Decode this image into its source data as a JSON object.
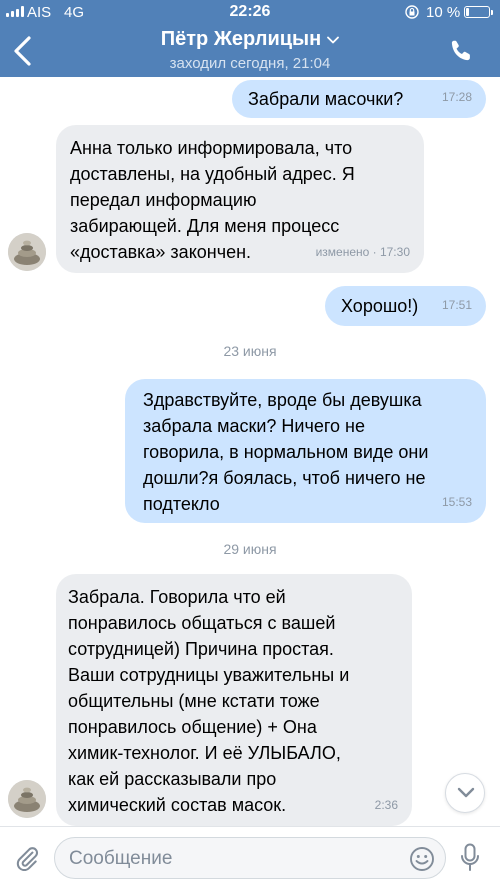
{
  "status_bar": {
    "carrier": "AIS",
    "network": "4G",
    "time": "22:26",
    "battery": "10 %",
    "battery_level": 0.1
  },
  "header": {
    "title": "Пётр Жерлицын",
    "subtitle": "заходил сегодня, 21:04",
    "colors": {
      "bar": "#5181b8"
    }
  },
  "messages": [
    {
      "dir": "out",
      "text": "Забрали масочки?",
      "time": "17:28"
    },
    {
      "dir": "in",
      "text": "Анна только информировала, что\nдоставлены, на удобный адрес. Я\nпередал информацию\nзабирающей. Для меня процесс\n«доставка» закончен.",
      "time": "изменено · 17:30"
    },
    {
      "dir": "out",
      "text": "Хорошо!)",
      "time": "17:51"
    },
    {
      "dir": "date",
      "text": "23 июня"
    },
    {
      "dir": "out",
      "text": "Здравствуйте, вроде бы девушка\nзабрала маски? Ничего не\nговорила, в нормальном виде они\nдошли?я боялась, чтоб ничего не\nподтекло",
      "time": "15:53"
    },
    {
      "dir": "date",
      "text": "29 июня"
    },
    {
      "dir": "in",
      "text": "Забрала. Говорила что ей\nпонравилось общаться с вашей\nсотрудницей) Причина простая.\nВаши сотрудницы уважительны и\nобщительны (мне кстати тоже\nпонравилось общение) + Она\nхимик-технолог. И её УЛЫБАЛО,\nкак ей рассказывали про\nхимический состав масок.",
      "time": "2:36"
    }
  ],
  "composer": {
    "placeholder": "Сообщение"
  },
  "colors": {
    "incoming": "#ebedf0",
    "outgoing": "#cce4ff",
    "meta": "#8e99a6"
  }
}
